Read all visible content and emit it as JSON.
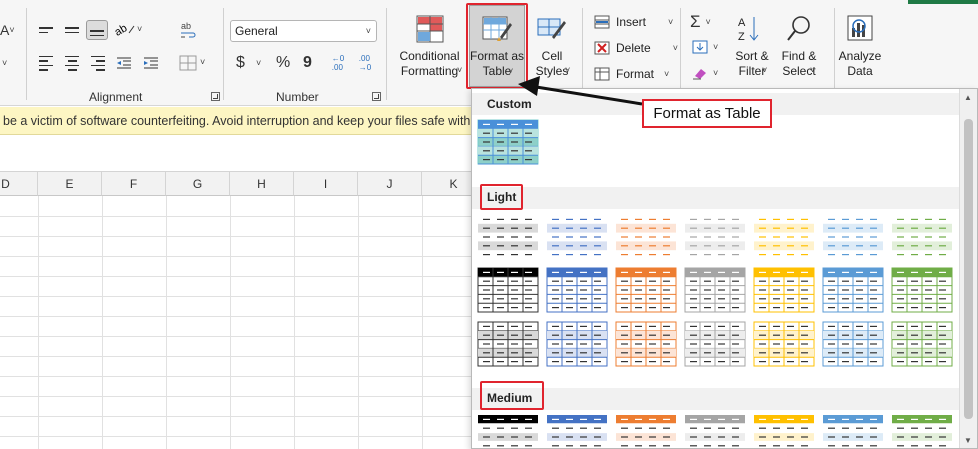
{
  "ribbon": {
    "partial_glyph": "A",
    "alignment": {
      "label": "Alignment"
    },
    "number": {
      "label": "Number",
      "format_value": "General",
      "currency": "$",
      "percent": "%",
      "comma": "9",
      "increase_decimal": "←0\n.00",
      "decrease_decimal": ".00\n→0"
    },
    "styles": {
      "conditional_formatting": "Conditional\nFormatting",
      "format_as_table": "Format as\nTable",
      "cell_styles": "Cell\nStyles"
    },
    "cells": {
      "insert": "Insert",
      "delete": "Delete",
      "format": "Format"
    },
    "editing": {
      "sort_filter": "Sort &\nFilter",
      "find_select": "Find &\nSelect"
    },
    "analysis": {
      "analyze_data": "Analyze\nData"
    }
  },
  "banner": {
    "text": "be a victim of software counterfeiting. Avoid interruption and keep your files safe with ge"
  },
  "sheet": {
    "columns": [
      "D",
      "E",
      "F",
      "G",
      "H",
      "I",
      "J",
      "K"
    ]
  },
  "gallery": {
    "sections": {
      "custom": "Custom",
      "light": "Light",
      "medium": "Medium"
    },
    "theme_colors": [
      "#333333",
      "#4472c4",
      "#ed7d31",
      "#a5a5a5",
      "#ffc000",
      "#5b9bd5",
      "#70ad47"
    ],
    "light_tints": [
      "#d9d9d9",
      "#d9e1f2",
      "#fce4d6",
      "#ededed",
      "#fff2cc",
      "#ddebf7",
      "#e2efda"
    ],
    "custom_color": "#8ed0c8",
    "accent_red": "#e0242e"
  },
  "callout": {
    "text": "Format as Table"
  }
}
